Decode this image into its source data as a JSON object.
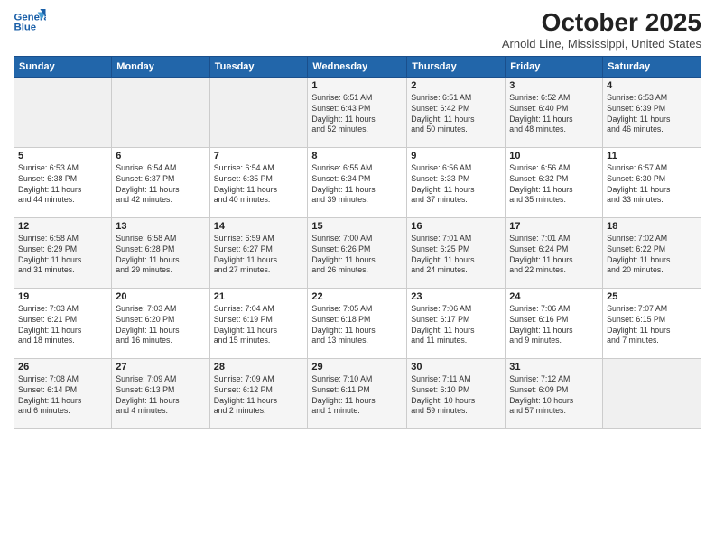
{
  "header": {
    "logo_line1": "General",
    "logo_line2": "Blue",
    "month": "October 2025",
    "location": "Arnold Line, Mississippi, United States"
  },
  "weekdays": [
    "Sunday",
    "Monday",
    "Tuesday",
    "Wednesday",
    "Thursday",
    "Friday",
    "Saturday"
  ],
  "weeks": [
    [
      {
        "day": "",
        "info": ""
      },
      {
        "day": "",
        "info": ""
      },
      {
        "day": "",
        "info": ""
      },
      {
        "day": "1",
        "info": "Sunrise: 6:51 AM\nSunset: 6:43 PM\nDaylight: 11 hours\nand 52 minutes."
      },
      {
        "day": "2",
        "info": "Sunrise: 6:51 AM\nSunset: 6:42 PM\nDaylight: 11 hours\nand 50 minutes."
      },
      {
        "day": "3",
        "info": "Sunrise: 6:52 AM\nSunset: 6:40 PM\nDaylight: 11 hours\nand 48 minutes."
      },
      {
        "day": "4",
        "info": "Sunrise: 6:53 AM\nSunset: 6:39 PM\nDaylight: 11 hours\nand 46 minutes."
      }
    ],
    [
      {
        "day": "5",
        "info": "Sunrise: 6:53 AM\nSunset: 6:38 PM\nDaylight: 11 hours\nand 44 minutes."
      },
      {
        "day": "6",
        "info": "Sunrise: 6:54 AM\nSunset: 6:37 PM\nDaylight: 11 hours\nand 42 minutes."
      },
      {
        "day": "7",
        "info": "Sunrise: 6:54 AM\nSunset: 6:35 PM\nDaylight: 11 hours\nand 40 minutes."
      },
      {
        "day": "8",
        "info": "Sunrise: 6:55 AM\nSunset: 6:34 PM\nDaylight: 11 hours\nand 39 minutes."
      },
      {
        "day": "9",
        "info": "Sunrise: 6:56 AM\nSunset: 6:33 PM\nDaylight: 11 hours\nand 37 minutes."
      },
      {
        "day": "10",
        "info": "Sunrise: 6:56 AM\nSunset: 6:32 PM\nDaylight: 11 hours\nand 35 minutes."
      },
      {
        "day": "11",
        "info": "Sunrise: 6:57 AM\nSunset: 6:30 PM\nDaylight: 11 hours\nand 33 minutes."
      }
    ],
    [
      {
        "day": "12",
        "info": "Sunrise: 6:58 AM\nSunset: 6:29 PM\nDaylight: 11 hours\nand 31 minutes."
      },
      {
        "day": "13",
        "info": "Sunrise: 6:58 AM\nSunset: 6:28 PM\nDaylight: 11 hours\nand 29 minutes."
      },
      {
        "day": "14",
        "info": "Sunrise: 6:59 AM\nSunset: 6:27 PM\nDaylight: 11 hours\nand 27 minutes."
      },
      {
        "day": "15",
        "info": "Sunrise: 7:00 AM\nSunset: 6:26 PM\nDaylight: 11 hours\nand 26 minutes."
      },
      {
        "day": "16",
        "info": "Sunrise: 7:01 AM\nSunset: 6:25 PM\nDaylight: 11 hours\nand 24 minutes."
      },
      {
        "day": "17",
        "info": "Sunrise: 7:01 AM\nSunset: 6:24 PM\nDaylight: 11 hours\nand 22 minutes."
      },
      {
        "day": "18",
        "info": "Sunrise: 7:02 AM\nSunset: 6:22 PM\nDaylight: 11 hours\nand 20 minutes."
      }
    ],
    [
      {
        "day": "19",
        "info": "Sunrise: 7:03 AM\nSunset: 6:21 PM\nDaylight: 11 hours\nand 18 minutes."
      },
      {
        "day": "20",
        "info": "Sunrise: 7:03 AM\nSunset: 6:20 PM\nDaylight: 11 hours\nand 16 minutes."
      },
      {
        "day": "21",
        "info": "Sunrise: 7:04 AM\nSunset: 6:19 PM\nDaylight: 11 hours\nand 15 minutes."
      },
      {
        "day": "22",
        "info": "Sunrise: 7:05 AM\nSunset: 6:18 PM\nDaylight: 11 hours\nand 13 minutes."
      },
      {
        "day": "23",
        "info": "Sunrise: 7:06 AM\nSunset: 6:17 PM\nDaylight: 11 hours\nand 11 minutes."
      },
      {
        "day": "24",
        "info": "Sunrise: 7:06 AM\nSunset: 6:16 PM\nDaylight: 11 hours\nand 9 minutes."
      },
      {
        "day": "25",
        "info": "Sunrise: 7:07 AM\nSunset: 6:15 PM\nDaylight: 11 hours\nand 7 minutes."
      }
    ],
    [
      {
        "day": "26",
        "info": "Sunrise: 7:08 AM\nSunset: 6:14 PM\nDaylight: 11 hours\nand 6 minutes."
      },
      {
        "day": "27",
        "info": "Sunrise: 7:09 AM\nSunset: 6:13 PM\nDaylight: 11 hours\nand 4 minutes."
      },
      {
        "day": "28",
        "info": "Sunrise: 7:09 AM\nSunset: 6:12 PM\nDaylight: 11 hours\nand 2 minutes."
      },
      {
        "day": "29",
        "info": "Sunrise: 7:10 AM\nSunset: 6:11 PM\nDaylight: 11 hours\nand 1 minute."
      },
      {
        "day": "30",
        "info": "Sunrise: 7:11 AM\nSunset: 6:10 PM\nDaylight: 10 hours\nand 59 minutes."
      },
      {
        "day": "31",
        "info": "Sunrise: 7:12 AM\nSunset: 6:09 PM\nDaylight: 10 hours\nand 57 minutes."
      },
      {
        "day": "",
        "info": ""
      }
    ]
  ]
}
